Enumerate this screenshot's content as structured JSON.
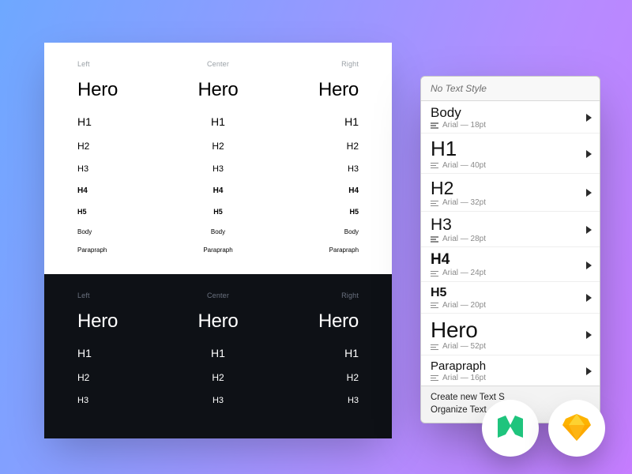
{
  "artboard": {
    "alignments": {
      "left": "Left",
      "center": "Center",
      "right": "Right"
    },
    "samples": {
      "hero": "Hero",
      "h1": "H1",
      "h2": "H2",
      "h3": "H3",
      "h4": "H4",
      "h5": "H5",
      "body": "Body",
      "para": "Parapraph"
    }
  },
  "panel": {
    "header": "No Text Style",
    "styles": [
      {
        "key": "body",
        "name": "Body",
        "meta": "Arial — 18pt"
      },
      {
        "key": "h1",
        "name": "H1",
        "meta": "Arial — 40pt"
      },
      {
        "key": "h2",
        "name": "H2",
        "meta": "Arial — 32pt"
      },
      {
        "key": "h3",
        "name": "H3",
        "meta": "Arial — 28pt"
      },
      {
        "key": "h4",
        "name": "H4",
        "meta": "Arial — 24pt"
      },
      {
        "key": "h5",
        "name": "H5",
        "meta": "Arial — 20pt"
      },
      {
        "key": "hero",
        "name": "Hero",
        "meta": "Arial — 52pt"
      },
      {
        "key": "para",
        "name": "Parapraph",
        "meta": "Arial — 16pt"
      }
    ],
    "footer": {
      "create": "Create new Text S",
      "organize": "Organize Text"
    }
  },
  "badges": {
    "medium": "medium-icon",
    "sketch": "sketch-icon"
  }
}
